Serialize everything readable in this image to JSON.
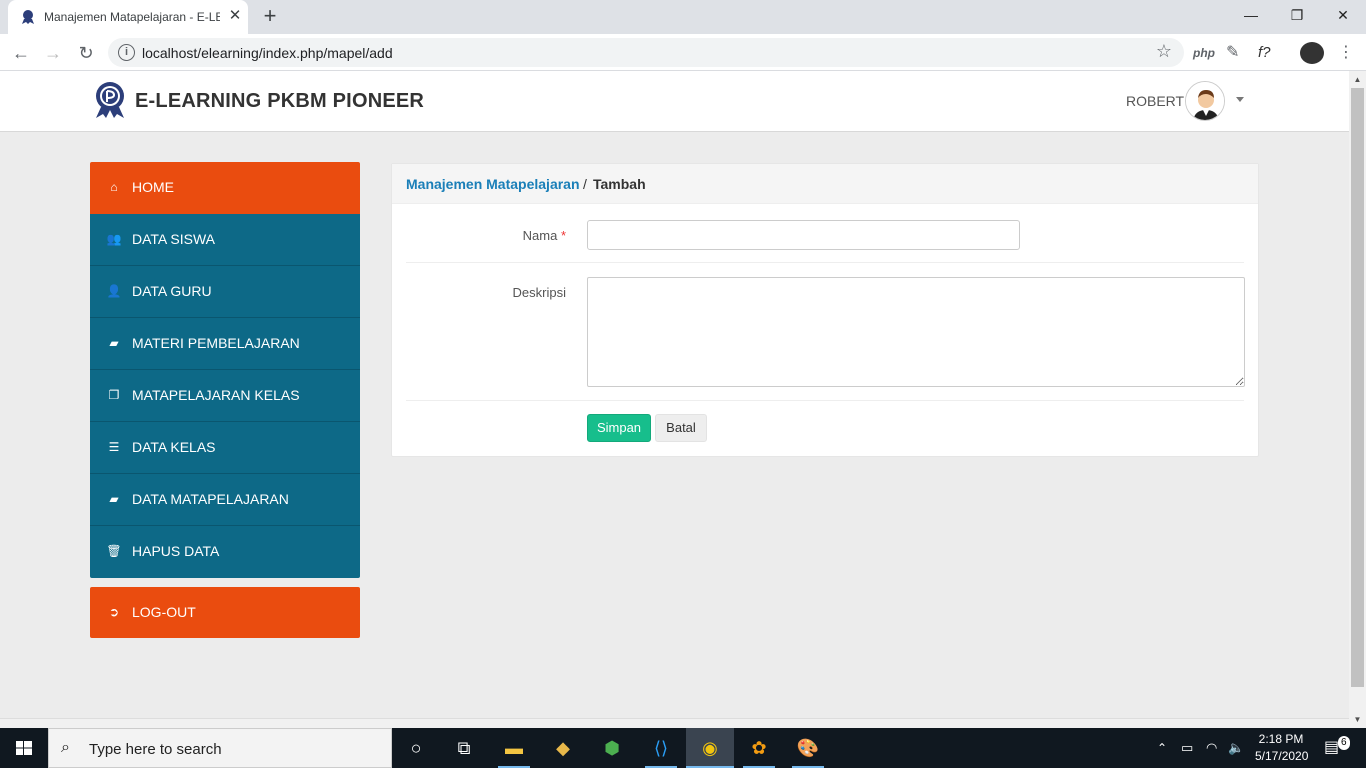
{
  "browser": {
    "tab_title": "Manajemen Matapelajaran - E-LE",
    "url": "localhost/elearning/index.php/mapel/add",
    "extensions": [
      "php",
      "f?"
    ]
  },
  "header": {
    "brand": "E-LEARNING PKBM PIONEER",
    "username": "ROBERT"
  },
  "sidebar": {
    "items": [
      {
        "label": "HOME",
        "icon": "home-icon",
        "glyph": "⌂"
      },
      {
        "label": "DATA SISWA",
        "icon": "users-icon",
        "glyph": "👥"
      },
      {
        "label": "DATA GURU",
        "icon": "user-icon",
        "glyph": "👤"
      },
      {
        "label": "MATERI PEMBELAJARAN",
        "icon": "book-icon",
        "glyph": "▰"
      },
      {
        "label": "MATAPELAJARAN KELAS",
        "icon": "files-icon",
        "glyph": "❐"
      },
      {
        "label": "DATA KELAS",
        "icon": "list-icon",
        "glyph": "☰"
      },
      {
        "label": "DATA MATAPELAJARAN",
        "icon": "book-icon",
        "glyph": "▰"
      },
      {
        "label": "HAPUS DATA",
        "icon": "trash-icon",
        "glyph": "🗑"
      }
    ],
    "logout": {
      "label": "LOG-OUT",
      "icon": "sign-out-icon",
      "glyph": "➲"
    }
  },
  "main": {
    "breadcrumb_link": "Manajemen Matapelajaran",
    "breadcrumb_sep": "/",
    "breadcrumb_current": "Tambah",
    "form": {
      "nama_label": "Nama",
      "required_mark": "*",
      "nama_value": "",
      "deskripsi_label": "Deskripsi",
      "deskripsi_value": "",
      "save_label": "Simpan",
      "cancel_label": "Batal"
    }
  },
  "taskbar": {
    "search_placeholder": "Type here to search",
    "time": "2:18 PM",
    "date": "5/17/2020",
    "notification_count": "6"
  },
  "colors": {
    "menu_active": "#ea4c0f",
    "menu_default": "#0d6987",
    "link": "#1a7fb8",
    "save_button": "#17be8c"
  }
}
